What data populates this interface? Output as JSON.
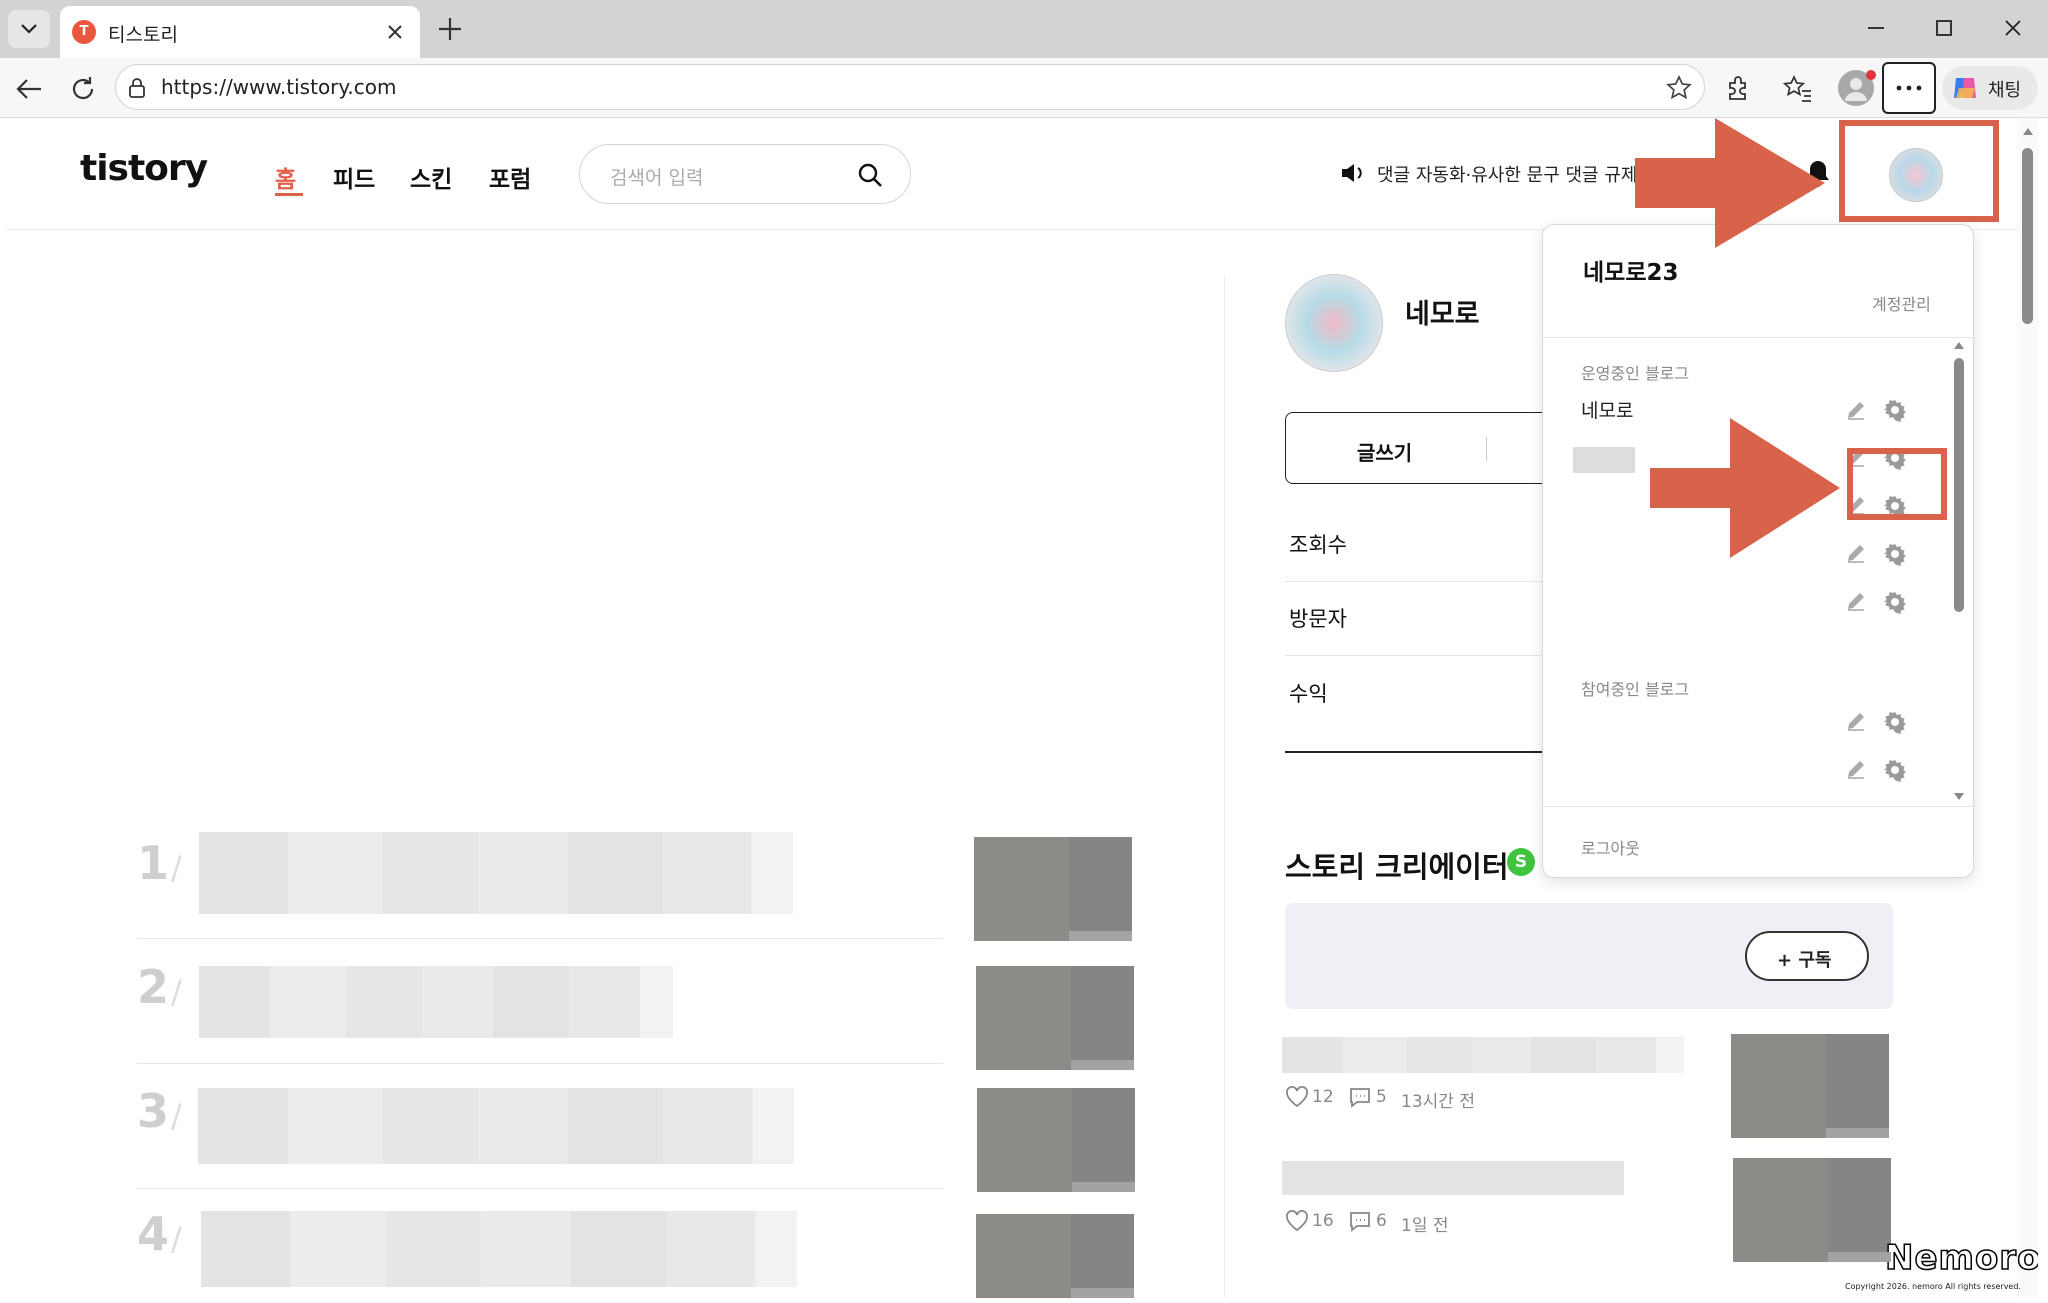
{
  "browser": {
    "tab_title": "티스토리",
    "url": "https://www.tistory.com",
    "chat_label": "채팅"
  },
  "site": {
    "logo": "tistory",
    "nav": [
      "홈",
      "피드",
      "스킨",
      "포럼"
    ],
    "search_placeholder": "검색어 입력",
    "notice": "댓글 자동화·유사한 문구 댓글 규제"
  },
  "profile": {
    "name": "네모로",
    "write_label": "글쓰기",
    "stats": [
      "조회수",
      "방문자",
      "수익"
    ]
  },
  "dropdown": {
    "username": "네모로23",
    "account_manage": "계정관리",
    "section_running": "운영중인 블로그",
    "running_blogs": [
      "네모로"
    ],
    "section_joined": "참여중인 블로그",
    "logout": "로그아웃"
  },
  "creator": {
    "title": "스토리 크리에이터",
    "badge": "S",
    "subscribe": "+ 구독",
    "posts": [
      {
        "likes": "12",
        "comments": "5",
        "time": "13시간 전"
      },
      {
        "likes": "16",
        "comments": "6",
        "time": "1일 전"
      }
    ]
  },
  "ranking": [
    "1",
    "2",
    "3",
    "4"
  ],
  "watermark": {
    "brand": "Nemoro",
    "copyright": "Copyright 2026. nemoro All rights reserved."
  },
  "colors": {
    "accent": "#e0604a",
    "annotation": "#d9634a"
  }
}
